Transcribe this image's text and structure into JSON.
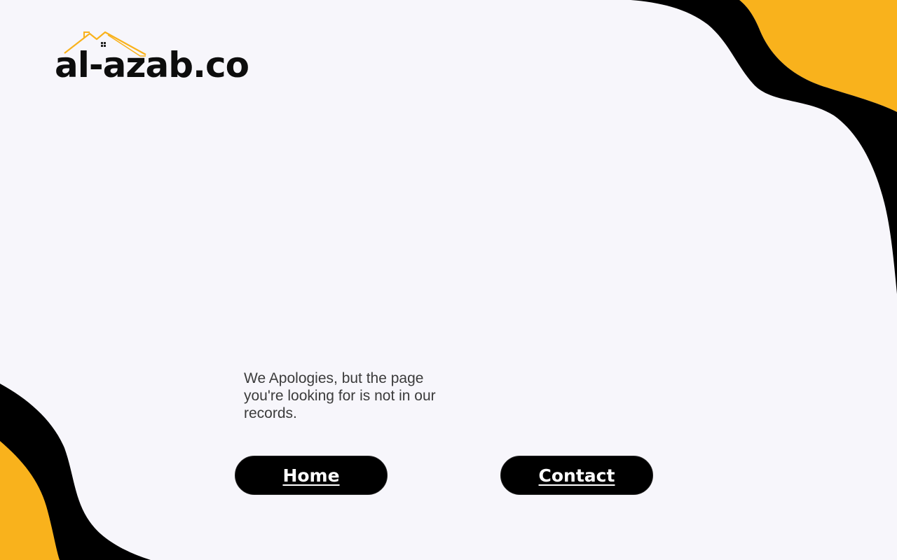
{
  "brand": {
    "logo_text": "al-azab.co"
  },
  "error": {
    "message": "We Apologies, but the page you're looking for is not in our records."
  },
  "actions": {
    "home_label": "Home",
    "contact_label": "Contact"
  },
  "colors": {
    "accent": "#f9b21c",
    "background": "#f7f6fb",
    "dark": "#000000",
    "text": "#3b3b3b"
  }
}
